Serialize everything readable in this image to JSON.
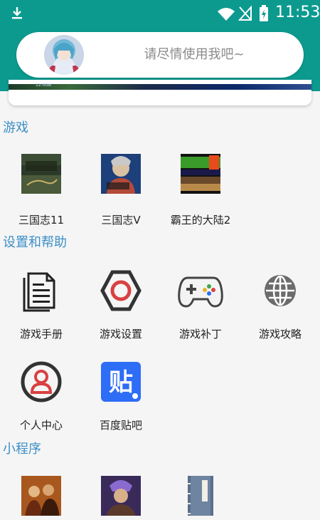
{
  "status_bar": {
    "time": "11:53"
  },
  "search": {
    "placeholder": "请尽情使用我吧~"
  },
  "banner": {
    "text": "12.0GB"
  },
  "sections": {
    "games": {
      "title": "游戏",
      "items": [
        {
          "label": "三国志11"
        },
        {
          "label": "三国志V"
        },
        {
          "label": "霸王的大陆2"
        }
      ]
    },
    "settings": {
      "title": "设置和帮助",
      "items": [
        {
          "label": "游戏手册",
          "icon": "document-icon"
        },
        {
          "label": "游戏设置",
          "icon": "hexagon-settings-icon"
        },
        {
          "label": "游戏补丁",
          "icon": "gamepad-icon"
        },
        {
          "label": "游戏攻略",
          "icon": "globe-icon"
        },
        {
          "label": "个人中心",
          "icon": "user-icon"
        },
        {
          "label": "百度贴吧",
          "icon": "tieba-icon"
        }
      ]
    },
    "mini": {
      "title": "小程序"
    }
  },
  "colors": {
    "header": "#0c9a8f",
    "section_title": "#3c8fc7",
    "tieba": "#2e6df6",
    "accent_red": "#d84141"
  }
}
